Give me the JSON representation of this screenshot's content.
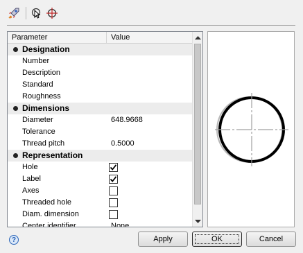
{
  "toolbar": {
    "icons": [
      "rocket-icon",
      "pointer-select-icon",
      "crosshair-icon"
    ]
  },
  "grid": {
    "columns": [
      "Parameter",
      "Value"
    ],
    "rows": [
      {
        "kind": "category",
        "label": "Designation"
      },
      {
        "kind": "text",
        "label": "Number",
        "value": ""
      },
      {
        "kind": "text",
        "label": "Description",
        "value": ""
      },
      {
        "kind": "text",
        "label": "Standard",
        "value": ""
      },
      {
        "kind": "text",
        "label": "Roughness",
        "value": ""
      },
      {
        "kind": "category",
        "label": "Dimensions"
      },
      {
        "kind": "text",
        "label": "Diameter",
        "value": "648.9668"
      },
      {
        "kind": "text",
        "label": "Tolerance",
        "value": ""
      },
      {
        "kind": "text",
        "label": "Thread pitch",
        "value": "0.5000"
      },
      {
        "kind": "category",
        "label": "Representation"
      },
      {
        "kind": "check",
        "label": "Hole",
        "checked": true
      },
      {
        "kind": "check",
        "label": "Label",
        "checked": true
      },
      {
        "kind": "check",
        "label": "Axes",
        "checked": false
      },
      {
        "kind": "check",
        "label": "Threaded hole",
        "checked": false
      },
      {
        "kind": "check",
        "label": "Diam. dimension",
        "checked": false
      },
      {
        "kind": "text",
        "label": "Center identifier",
        "value": "None"
      }
    ]
  },
  "buttons": {
    "help": "?",
    "apply": "Apply",
    "ok": "OK",
    "cancel": "Cancel"
  }
}
